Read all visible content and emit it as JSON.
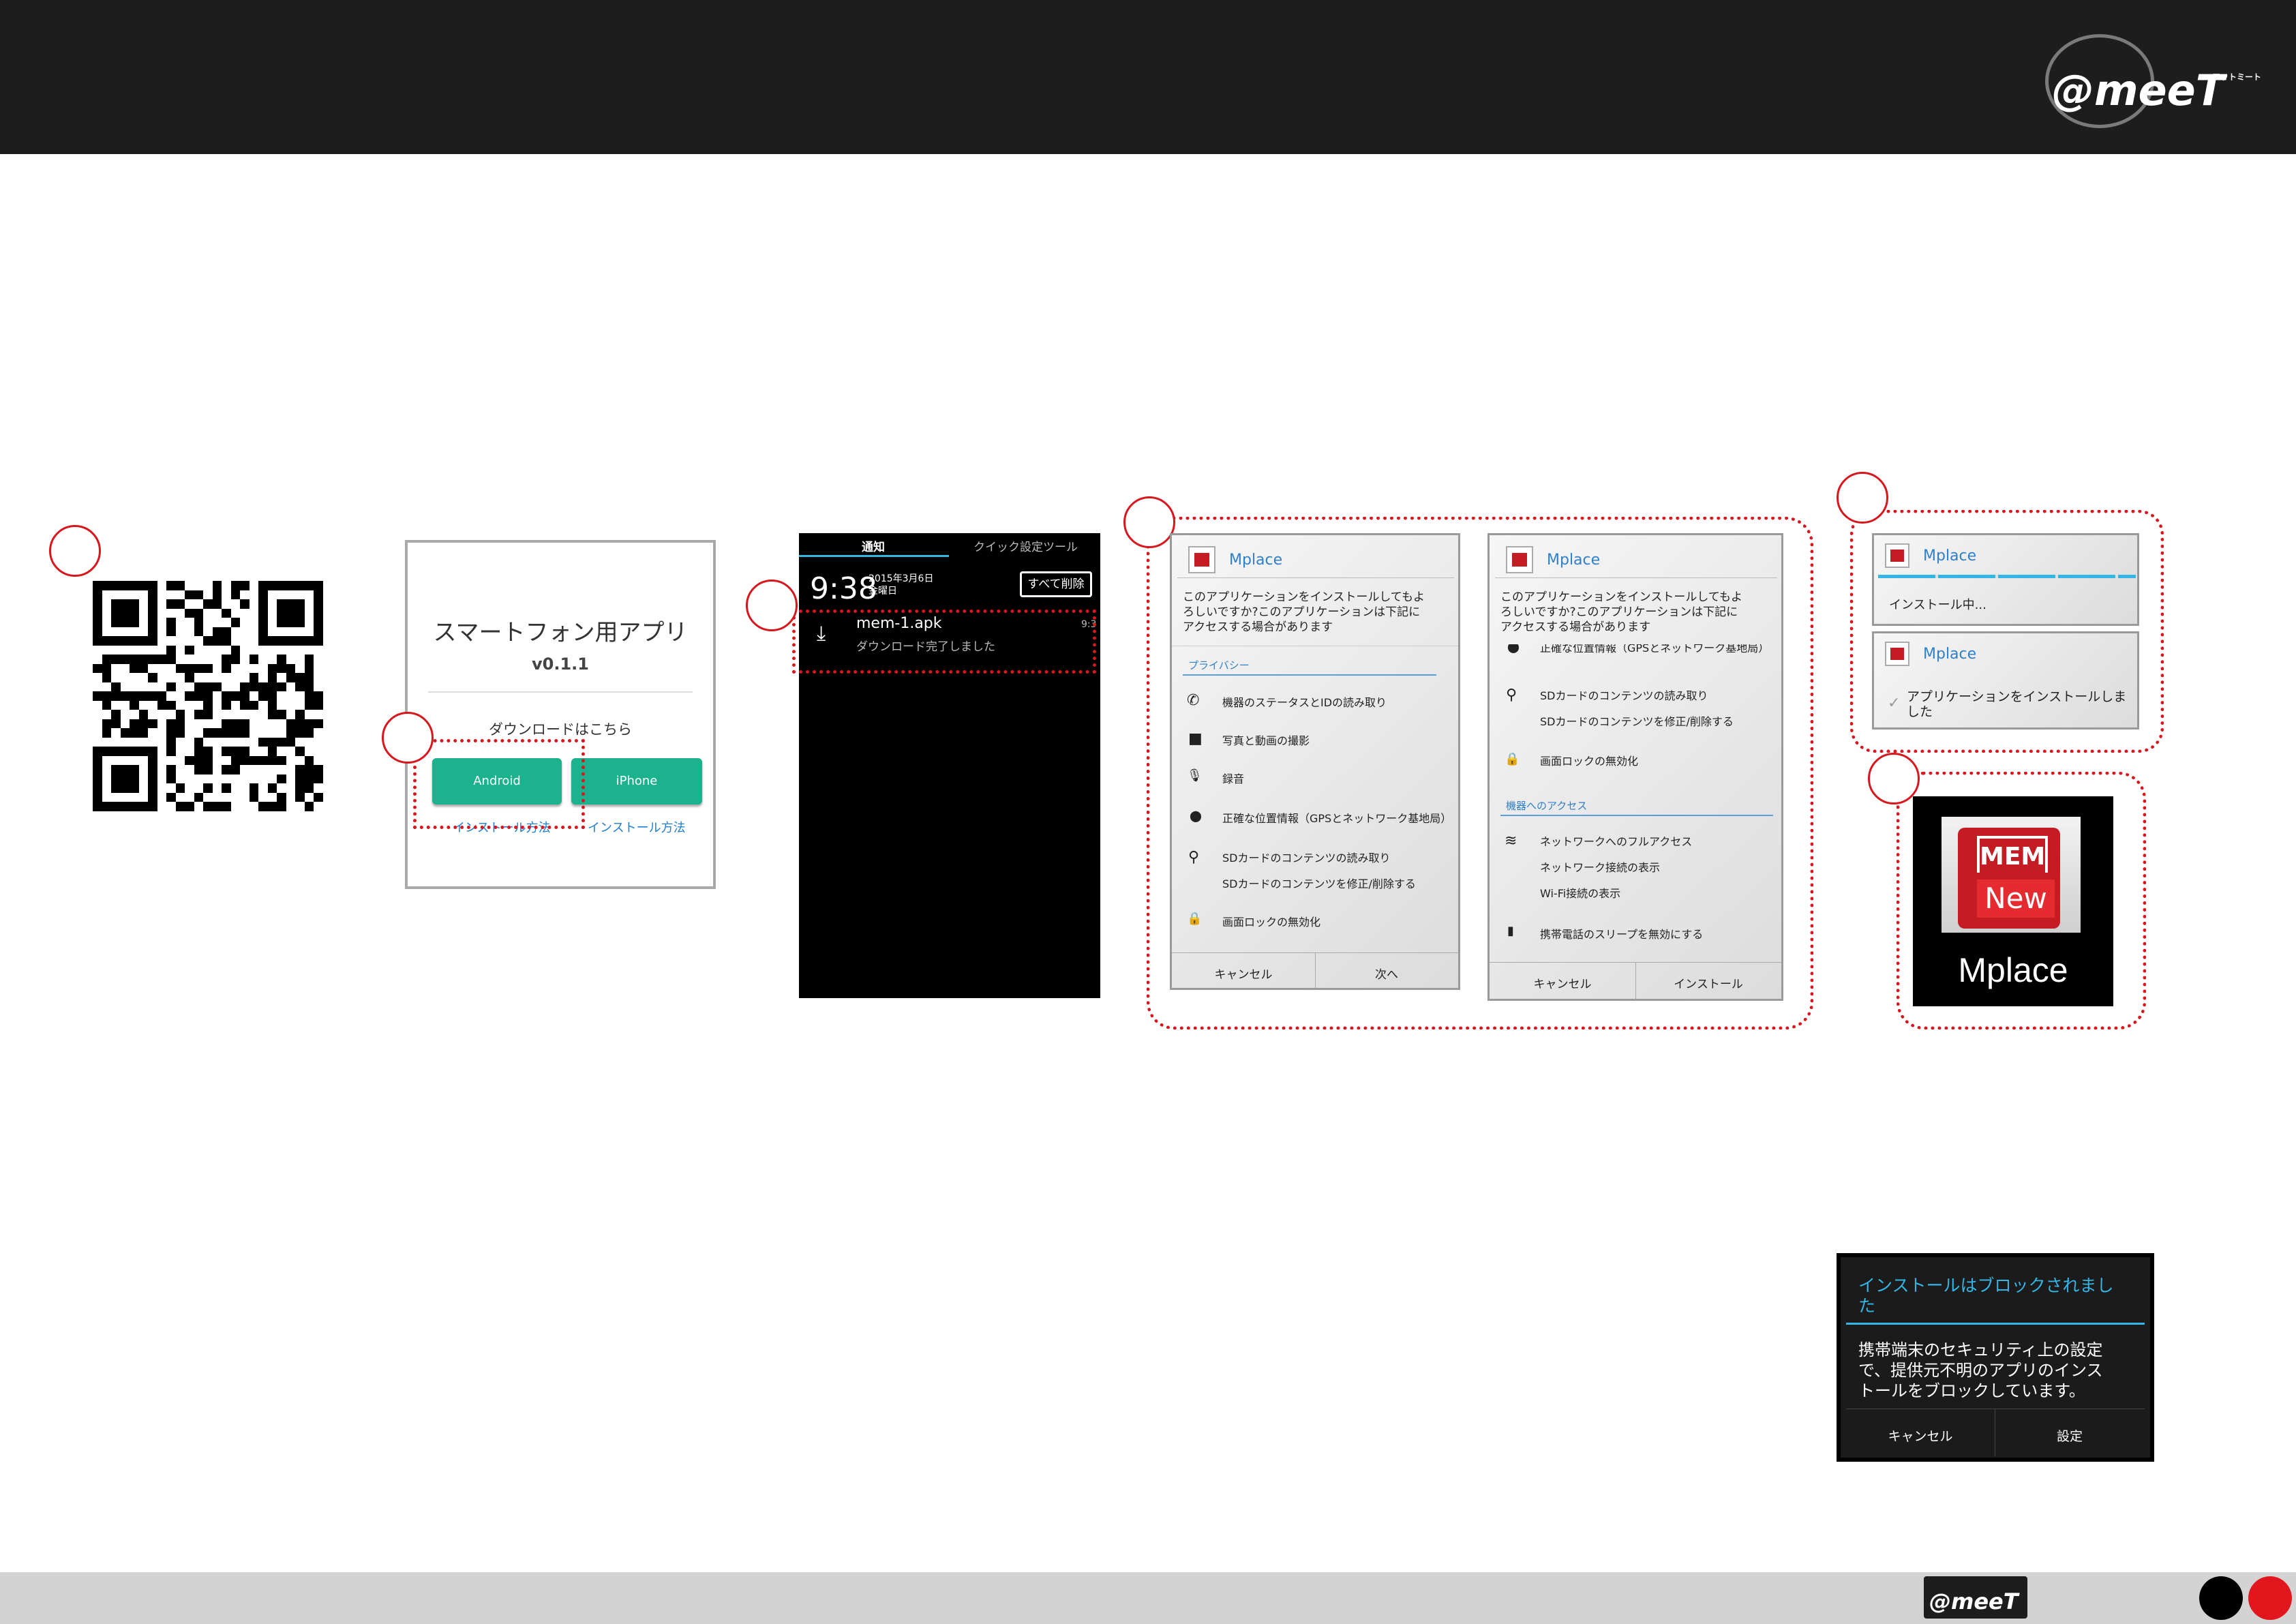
{
  "brand": {
    "logo_text": "@meeT",
    "logo_kana": "アットミート"
  },
  "download_page": {
    "title": "スマートフォン用アプリ",
    "version": "v0.1.1",
    "download_label": "ダウンロードはこちら",
    "android_button": "Android",
    "iphone_button": "iPhone",
    "install_link_android": "インストール方法",
    "install_link_iphone": "インストール方法"
  },
  "notification": {
    "tab_notifications": "通知",
    "tab_quick_settings": "クイック設定ツール",
    "time": "9:38",
    "date": "2015年3月6日",
    "weekday": "金曜日",
    "clear_all": "すべて削除",
    "file_name": "mem-1.apk",
    "status": "ダウンロード完了しました",
    "item_time": "9:3"
  },
  "install_dialog_1": {
    "app_name": "Mplace",
    "prompt": [
      "このアプリケーションをインストールしてもよ",
      "ろしいですか?このアプリケーションは下記に",
      "アクセスする場合があります"
    ],
    "section": "プライバシー",
    "permissions": [
      {
        "icon": "phone-icon",
        "glyph": "✆",
        "lines": [
          "機器のステータスとIDの読み取り"
        ]
      },
      {
        "icon": "camera-icon",
        "glyph": "■",
        "lines": [
          "写真と動画の撮影"
        ]
      },
      {
        "icon": "microphone-icon",
        "glyph": "🎙",
        "lines": [
          "録音"
        ]
      },
      {
        "icon": "location-icon",
        "glyph": "⬤",
        "lines": [
          "正確な位置情報（GPSとネットワーク基地局）"
        ]
      },
      {
        "icon": "usb-icon",
        "glyph": "⚲",
        "lines": [
          "SDカードのコンテンツの読み取り",
          "SDカードのコンテンツを修正/削除する"
        ]
      },
      {
        "icon": "lock-icon",
        "glyph": "🔒",
        "lines": [
          "画面ロックの無効化"
        ]
      }
    ],
    "cancel": "キャンセル",
    "next": "次へ"
  },
  "install_dialog_2": {
    "app_name": "Mplace",
    "prompt": [
      "このアプリケーションをインストールしてもよ",
      "ろしいですか?このアプリケーションは下記に",
      "アクセスする場合があります"
    ],
    "permissions_top": [
      {
        "icon": "location-icon",
        "glyph": "⬤",
        "lines": [
          "正確な位置情報（GPSとネットワーク基地局）"
        ]
      },
      {
        "icon": "usb-icon",
        "glyph": "⚲",
        "lines": [
          "SDカードのコンテンツの読み取り",
          "SDカードのコンテンツを修正/削除する"
        ]
      },
      {
        "icon": "lock-icon",
        "glyph": "🔒",
        "lines": [
          "画面ロックの無効化"
        ]
      }
    ],
    "section": "機器へのアクセス",
    "permissions_bottom": [
      {
        "icon": "wifi-icon",
        "glyph": "≋",
        "lines": [
          "ネットワークへのフルアクセス",
          "ネットワーク接続の表示",
          "Wi-Fi接続の表示"
        ]
      },
      {
        "icon": "battery-icon",
        "glyph": "▮",
        "lines": [
          "携帯電話のスリープを無効にする"
        ]
      }
    ],
    "cancel": "キャンセル",
    "install": "インストール"
  },
  "installing": {
    "app_name": "Mplace",
    "status": "インストール中..."
  },
  "installed": {
    "app_name": "Mplace",
    "status_line1": "アプリケーションをインストールしま",
    "status_line2": "した"
  },
  "app_icon": {
    "badge_top": "MEM",
    "badge_bottom": "New",
    "label": "Mplace"
  },
  "blocked_dialog": {
    "title_line1": "インストールはブロックされまし",
    "title_line2": "た",
    "body": [
      "携帯端末のセキュリティ上の設定",
      "で、提供元不明のアプリのインス",
      "トールをブロックしています。"
    ],
    "cancel": "キャンセル",
    "settings": "設定"
  },
  "colors": {
    "accent_red": "#d8161d",
    "button_green": "#1bb28d",
    "link_blue": "#1d7fd1",
    "android_cyan": "#33b5e5"
  }
}
